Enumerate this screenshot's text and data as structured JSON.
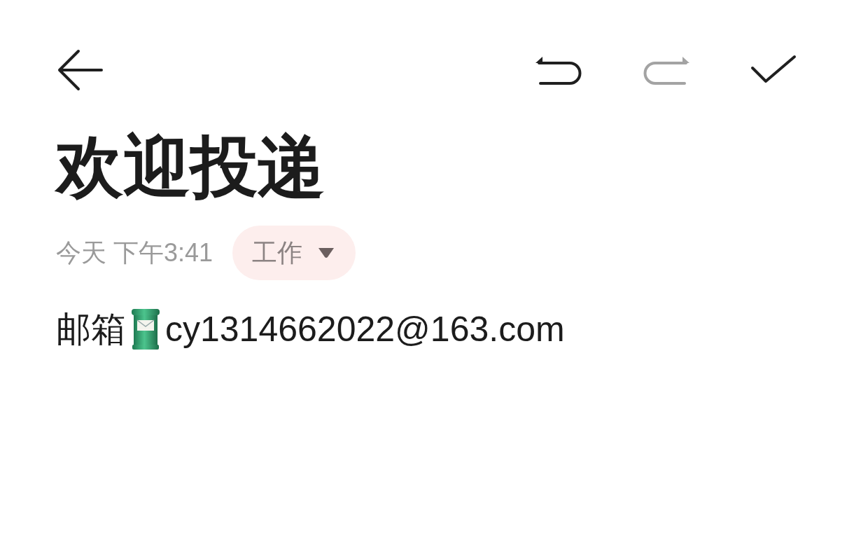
{
  "toolbar": [
    {
      "kind": "back",
      "disabled": false
    },
    {
      "kind": "undo",
      "disabled": false
    },
    {
      "kind": "redo",
      "disabled": true
    },
    {
      "kind": "confirm",
      "disabled": false
    }
  ],
  "note": {
    "title": "欢迎投递",
    "time": "今天 下午3:41",
    "category": "工作",
    "body": {
      "label": "邮箱",
      "text": "cy1314662022@163.com"
    }
  }
}
